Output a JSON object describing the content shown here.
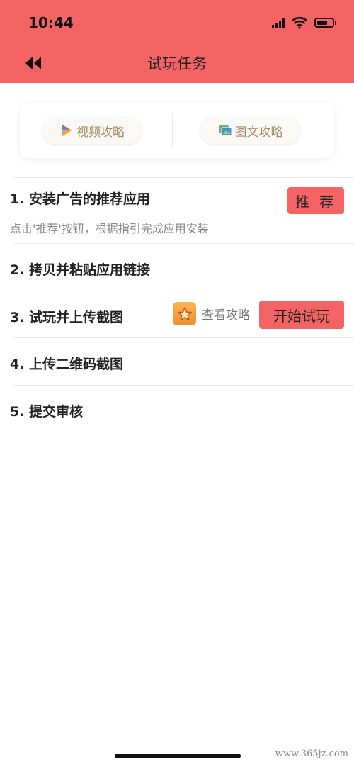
{
  "status_bar": {
    "time": "10:44"
  },
  "header": {
    "title": "试玩任务",
    "back_icon": "double-chevron-left-icon"
  },
  "guide": {
    "video_label": "视频攻略",
    "article_label": "图文攻略"
  },
  "steps": [
    {
      "title": "1. 安装广告的推荐应用",
      "desc": "点击'推荐'按钮，根据指引完成应用安装",
      "action_label": "推 荐"
    },
    {
      "title": "2. 拷贝并粘贴应用链接"
    },
    {
      "title": "3. 试玩并上传截图",
      "guide_label": "查看攻略",
      "action_label": "开始试玩"
    },
    {
      "title": "4. 上传二维码截图"
    },
    {
      "title": "5. 提交审核"
    }
  ],
  "watermark": "www.365jz.com",
  "colors": {
    "header_bg": "#f46464",
    "button_bg": "#f46464",
    "pill_text": "#a58a66",
    "star_badge": "#f5a040"
  }
}
